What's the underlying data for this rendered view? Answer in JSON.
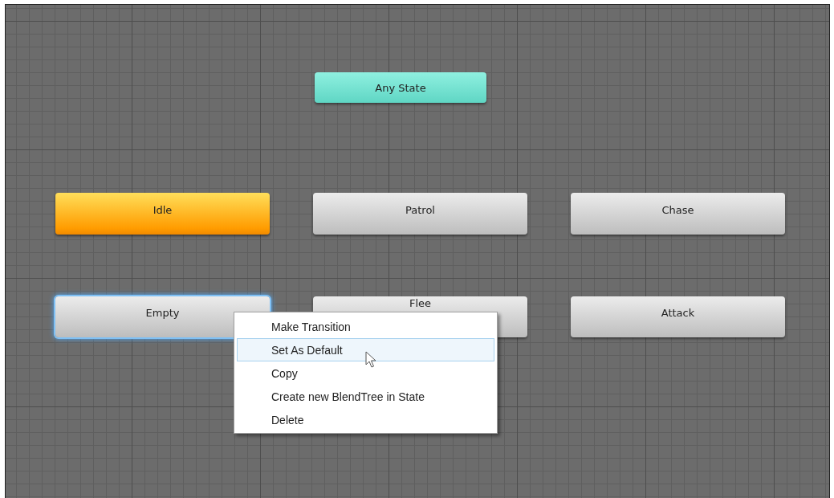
{
  "nodes": [
    {
      "label": "Any State",
      "kind": "any_state",
      "selected": false
    },
    {
      "label": "Idle",
      "kind": "default",
      "selected": false
    },
    {
      "label": "Patrol",
      "kind": "state",
      "selected": false
    },
    {
      "label": "Chase",
      "kind": "state",
      "selected": false
    },
    {
      "label": "Empty",
      "kind": "state",
      "selected": true
    },
    {
      "label": "Flee",
      "kind": "state",
      "selected": false
    },
    {
      "label": "Attack",
      "kind": "state",
      "selected": false
    }
  ],
  "context_menu": {
    "items": [
      {
        "label": "Make Transition",
        "selected": false
      },
      {
        "label": "Set As Default",
        "selected": true
      },
      {
        "label": "Copy",
        "selected": false
      },
      {
        "label": "Create new BlendTree in State",
        "selected": false
      },
      {
        "label": "Delete",
        "selected": false
      }
    ]
  }
}
